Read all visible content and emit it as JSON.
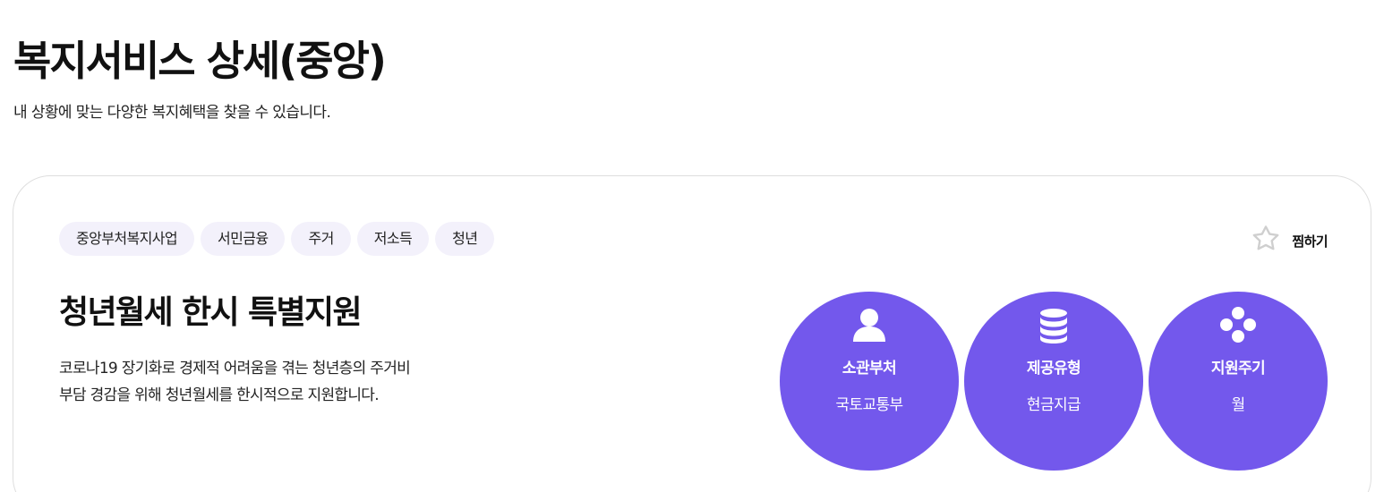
{
  "header": {
    "title": "복지서비스 상세(중앙)",
    "subtitle": "내 상황에 맞는 다양한 복지혜택을 찾을 수 있습니다."
  },
  "service": {
    "tags": [
      "중앙부처복지사업",
      "서민금융",
      "주거",
      "저소득",
      "청년"
    ],
    "bookmark_label": "찜하기",
    "title": "청년월세 한시 특별지원",
    "description_lines": [
      "코로나19 장기화로 경제적 어려움을 겪는 청년층의 주거비",
      "부담 경감을 위해 청년월세를 한시적으로 지원합니다."
    ],
    "info": [
      {
        "label": "소관부처",
        "value": "국토교통부",
        "icon": "person-icon"
      },
      {
        "label": "제공유형",
        "value": "현금지급",
        "icon": "coin-stack-icon"
      },
      {
        "label": "지원주기",
        "value": "월",
        "icon": "dots-diamond-icon"
      }
    ]
  },
  "colors": {
    "accent": "#7358ec",
    "tag_bg": "#f3f1fb",
    "card_border": "#dedede"
  }
}
